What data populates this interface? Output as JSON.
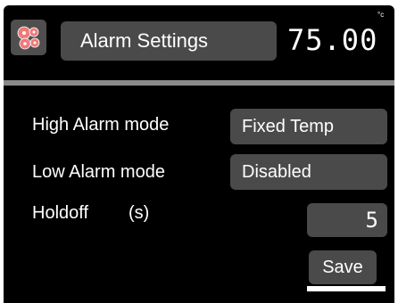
{
  "header": {
    "title": "Alarm Settings",
    "temperature": "75.00",
    "temperature_unit": "°c",
    "settings_icon": "gear-cluster-icon"
  },
  "settings": {
    "high_alarm": {
      "label": "High Alarm mode",
      "value": "Fixed Temp"
    },
    "low_alarm": {
      "label": "Low Alarm mode",
      "value": "Disabled"
    },
    "holdoff": {
      "label": "Holdoff",
      "unit": "(s)",
      "value": "5"
    }
  },
  "actions": {
    "save_label": "Save"
  },
  "colors": {
    "background": "#000000",
    "panel": "#4a4a4a",
    "divider": "#8a8a8a",
    "text": "#ffffff",
    "gear": "#f07a7a"
  }
}
